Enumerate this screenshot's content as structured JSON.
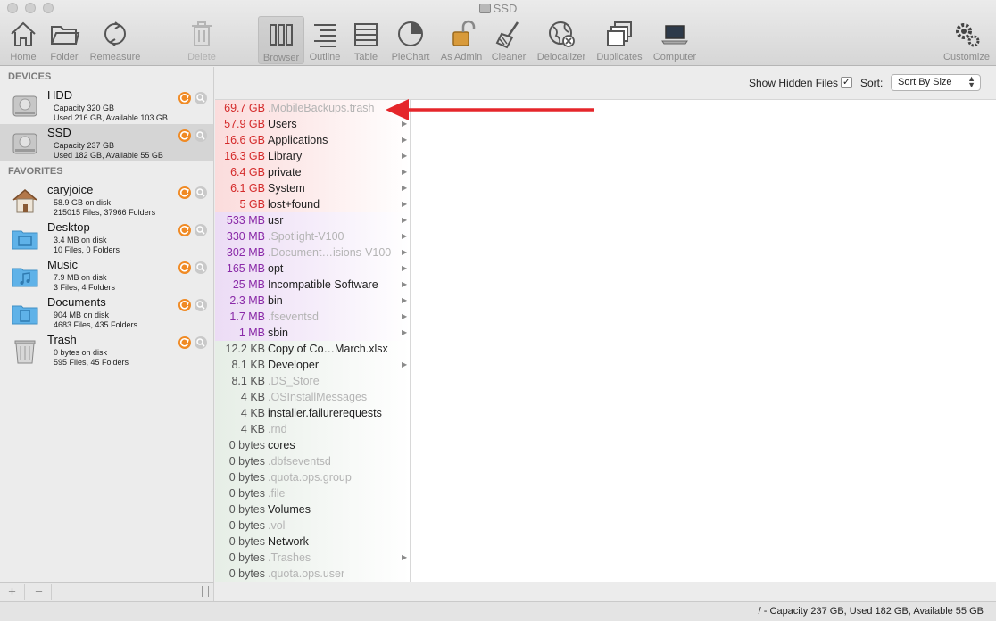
{
  "window": {
    "title": "SSD"
  },
  "toolbar": {
    "home": "Home",
    "folder": "Folder",
    "remeasure": "Remeasure",
    "delete": "Delete",
    "browser": "Browser",
    "outline": "Outline",
    "table": "Table",
    "piechart": "PieChart",
    "as_admin": "As Admin",
    "cleaner": "Cleaner",
    "delocalizer": "Delocalizer",
    "duplicates": "Duplicates",
    "computer": "Computer",
    "customize": "Customize"
  },
  "sidebar": {
    "devices_header": "DEVICES",
    "favorites_header": "FAVORITES",
    "devices": [
      {
        "name": "HDD",
        "line1": "Capacity 320 GB",
        "line2": "Used 216 GB, Available 103 GB"
      },
      {
        "name": "SSD",
        "line1": "Capacity 237 GB",
        "line2": "Used 182 GB, Available 55 GB"
      }
    ],
    "favorites": [
      {
        "name": "caryjoice",
        "line1": "58.9 GB on disk",
        "line2": "215015 Files, 37966 Folders"
      },
      {
        "name": "Desktop",
        "line1": "3.4 MB on disk",
        "line2": "10 Files, 0 Folders"
      },
      {
        "name": "Music",
        "line1": "7.9 MB on disk",
        "line2": "3 Files, 4 Folders"
      },
      {
        "name": "Documents",
        "line1": "904 MB on disk",
        "line2": "4683 Files, 435 Folders"
      },
      {
        "name": "Trash",
        "line1": "0 bytes on disk",
        "line2": "595 Files, 45 Folders"
      }
    ],
    "add_button": "+",
    "remove_button": "−"
  },
  "options": {
    "show_hidden_label": "Show Hidden Files",
    "show_hidden_checked": "✓",
    "sort_label": "Sort:",
    "sort_value": "Sort By Size"
  },
  "files": [
    {
      "size": "69.7 GB",
      "name": ".MobileBackups.trash"
    },
    {
      "size": "57.9 GB",
      "name": "Users"
    },
    {
      "size": "16.6 GB",
      "name": "Applications"
    },
    {
      "size": "16.3 GB",
      "name": "Library"
    },
    {
      "size": "6.4 GB",
      "name": "private"
    },
    {
      "size": "6.1 GB",
      "name": "System"
    },
    {
      "size": "5 GB",
      "name": "lost+found"
    },
    {
      "size": "533 MB",
      "name": "usr"
    },
    {
      "size": "330 MB",
      "name": ".Spotlight-V100"
    },
    {
      "size": "302 MB",
      "name": ".Document…isions-V100"
    },
    {
      "size": "165 MB",
      "name": "opt"
    },
    {
      "size": "25 MB",
      "name": "Incompatible Software"
    },
    {
      "size": "2.3 MB",
      "name": "bin"
    },
    {
      "size": "1.7 MB",
      "name": ".fseventsd"
    },
    {
      "size": "1 MB",
      "name": "sbin"
    },
    {
      "size": "12.2 KB",
      "name": "Copy of Co…March.xlsx"
    },
    {
      "size": "8.1 KB",
      "name": "Developer"
    },
    {
      "size": "8.1 KB",
      "name": ".DS_Store"
    },
    {
      "size": "4 KB",
      "name": ".OSInstallMessages"
    },
    {
      "size": "4 KB",
      "name": "installer.failurerequests"
    },
    {
      "size": "4 KB",
      "name": ".rnd"
    },
    {
      "size": "0 bytes",
      "name": "cores"
    },
    {
      "size": "0 bytes",
      "name": ".dbfseventsd"
    },
    {
      "size": "0 bytes",
      "name": ".quota.ops.group"
    },
    {
      "size": "0 bytes",
      "name": ".file"
    },
    {
      "size": "0 bytes",
      "name": "Volumes"
    },
    {
      "size": "0 bytes",
      "name": ".vol"
    },
    {
      "size": "0 bytes",
      "name": "Network"
    },
    {
      "size": "0 bytes",
      "name": ".Trashes"
    },
    {
      "size": "0 bytes",
      "name": ".quota.ops.user"
    }
  ],
  "status": {
    "text": "/ - Capacity 237 GB, Used 182 GB, Available 55 GB"
  },
  "colors": {
    "gb": "#d42a2a",
    "mb": "#8a2aa8",
    "annotation_arrow": "#e5262b",
    "action_orange": "#f08a24"
  }
}
